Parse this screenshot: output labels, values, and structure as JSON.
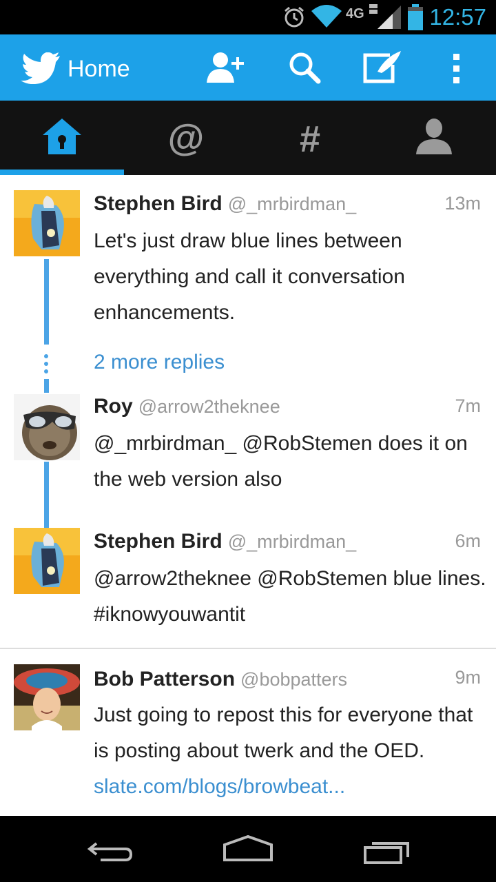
{
  "status_bar": {
    "time": "12:57",
    "network": "4G LTE",
    "icons": [
      "alarm-icon",
      "wifi-icon",
      "network-4g-lte-icon",
      "signal-icon",
      "battery-icon"
    ]
  },
  "action_bar": {
    "title": "Home",
    "accent_color": "#1da1e8",
    "actions": [
      "add-user-icon",
      "search-icon",
      "compose-icon",
      "overflow-menu-icon"
    ]
  },
  "tabs": [
    {
      "icon": "home-icon",
      "selected": true
    },
    {
      "icon": "mentions-icon",
      "label": "@",
      "selected": false
    },
    {
      "icon": "discover-icon",
      "label": "#",
      "selected": false
    },
    {
      "icon": "profile-icon",
      "selected": false
    }
  ],
  "timeline": {
    "tweets": [
      {
        "name": "Stephen Bird",
        "handle": "@_mrbirdman_",
        "time": "13m",
        "text": "Let's just draw blue lines between everything and call it conversation enhancements."
      },
      {
        "name": "Roy",
        "handle": "@arrow2theknee",
        "time": "7m",
        "text": "@_mrbirdman_ @RobStemen does it on the web version also"
      },
      {
        "name": "Stephen Bird",
        "handle": "@_mrbirdman_",
        "time": "6m",
        "text": "@arrow2theknee @RobStemen blue lines.  #iknowyouwantit"
      },
      {
        "name": "Bob Patterson",
        "handle": "@bobpatters",
        "time": "9m",
        "text": "Just going to repost this for everyone that is posting about twerk and the OED.",
        "link": "slate.com/blogs/browbeat..."
      }
    ],
    "more_replies": "2 more replies",
    "thread_line_color": "#4ba4e6",
    "link_color": "#3b8fd0"
  },
  "nav_bar": {
    "buttons": [
      "back-icon",
      "home-nav-icon",
      "recents-icon"
    ]
  }
}
